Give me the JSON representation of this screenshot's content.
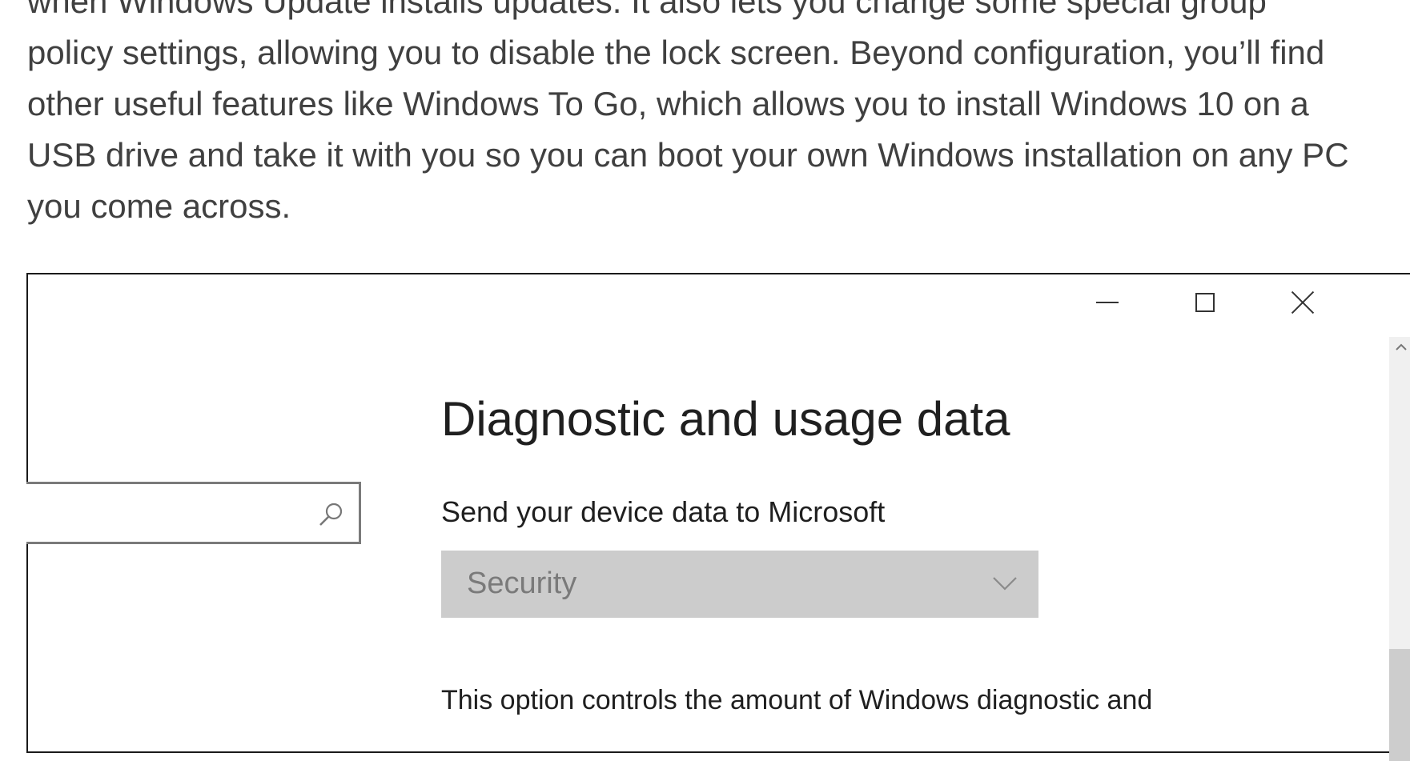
{
  "article": {
    "lines": [
      "when Windows Update installs updates. It also lets you change some special group",
      "policy settings, allowing you to disable the lock screen. Beyond configuration, you’ll find",
      "other useful features like Windows To Go, which allows you to install Windows 10 on a",
      "USB drive and take it with you so you can boot your own Windows installation on any PC",
      "you come across."
    ]
  },
  "window": {
    "controls": {
      "minimize": "minimize",
      "maximize": "maximize",
      "close": "close"
    },
    "search": {
      "value": "",
      "placeholder": ""
    },
    "heading": "Diagnostic and usage data",
    "send_label": "Send your device data to Microsoft",
    "dropdown": {
      "selected": "Security"
    },
    "description": "This option controls the amount of Windows diagnostic and"
  },
  "colors": {
    "text": "#404040",
    "dropdown_bg": "#cccccc",
    "dropdown_text": "#7a7a7a",
    "window_border": "#1a1a1a"
  },
  "icons": {
    "minimize": "minimize-icon",
    "maximize": "maximize-icon",
    "close": "close-icon",
    "search": "search-icon",
    "dropdown": "chevron-down-icon",
    "scroll_up": "chevron-up-icon"
  }
}
